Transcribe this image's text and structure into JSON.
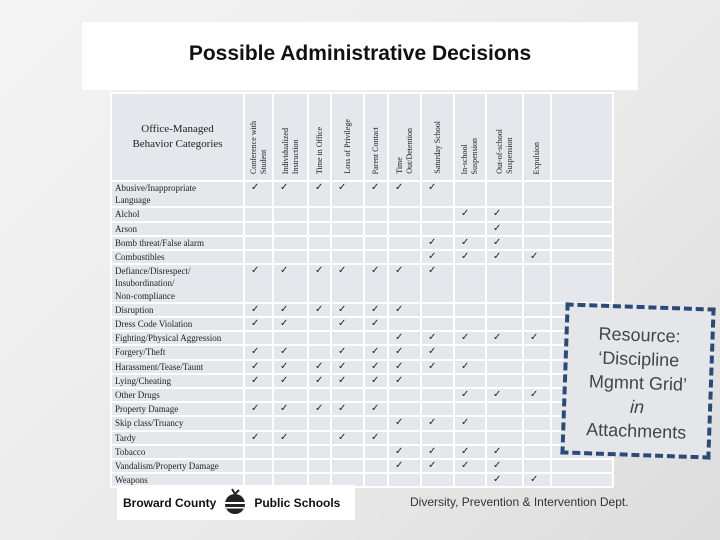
{
  "title": "Possible Administrative Decisions",
  "table": {
    "category_header": "Office-Managed\nBehavior Categories",
    "columns": [
      "Conference with\nStudent",
      "Individualized\nInstruction",
      "Time in Office",
      "Loss of Privilege",
      "Parent Contact",
      "Time\nOut/Detention",
      "Saturday School",
      "In-school\nSuspension",
      "Out-of-school\nSuspension",
      "Expulsion",
      ""
    ],
    "check_symbol": "✓",
    "rows": [
      {
        "label": "Abusive/Inappropriate\nLanguage",
        "checks": [
          1,
          2,
          3,
          4,
          5,
          6,
          7
        ]
      },
      {
        "label": "Alchol",
        "checks": [
          8,
          9
        ]
      },
      {
        "label": "Arson",
        "checks": [
          9
        ]
      },
      {
        "label": "Bomb threat/False alarm",
        "checks": [
          7,
          8,
          9
        ]
      },
      {
        "label": "Combustibles",
        "checks": [
          7,
          8,
          9,
          10
        ]
      },
      {
        "label": "Defiance/Disrespect/\nInsubordination/\nNon-compliance",
        "checks": [
          1,
          2,
          3,
          4,
          5,
          6,
          7
        ]
      },
      {
        "label": "Disruption",
        "checks": [
          1,
          2,
          3,
          4,
          5,
          6
        ]
      },
      {
        "label": "Dress Code Violation",
        "checks": [
          1,
          2,
          4,
          5
        ]
      },
      {
        "label": "Fighting/Physical Aggression",
        "checks": [
          6,
          7,
          8,
          9,
          10
        ]
      },
      {
        "label": "Forgery/Theft",
        "checks": [
          1,
          2,
          4,
          5,
          6,
          7
        ]
      },
      {
        "label": "Harassment/Tease/Taunt",
        "checks": [
          1,
          2,
          3,
          4,
          5,
          6,
          7,
          8
        ]
      },
      {
        "label": "Lying/Cheating",
        "checks": [
          1,
          2,
          3,
          4,
          5,
          6
        ]
      },
      {
        "label": "Other Drugs",
        "checks": [
          8,
          9,
          10
        ]
      },
      {
        "label": "Property Damage",
        "checks": [
          1,
          2,
          3,
          4,
          5
        ]
      },
      {
        "label": "Skip class/Truancy",
        "checks": [
          6,
          7,
          8
        ]
      },
      {
        "label": "Tardy",
        "checks": [
          1,
          2,
          4,
          5
        ]
      },
      {
        "label": "Tobacco",
        "checks": [
          6,
          7,
          8,
          9
        ]
      },
      {
        "label": "Vandalism/Property Damage",
        "checks": [
          6,
          7,
          8,
          9
        ]
      },
      {
        "label": "Weapons",
        "checks": [
          9,
          10
        ]
      }
    ]
  },
  "callout": {
    "line1": "Resource:",
    "line2": "‘Discipline",
    "line3": "Mgmnt Grid’",
    "line4": "in",
    "line5": "Attachments"
  },
  "logo": {
    "left": "Broward County",
    "right": "Public Schools"
  },
  "footer": "Diversity,  Prevention & Intervention Dept."
}
